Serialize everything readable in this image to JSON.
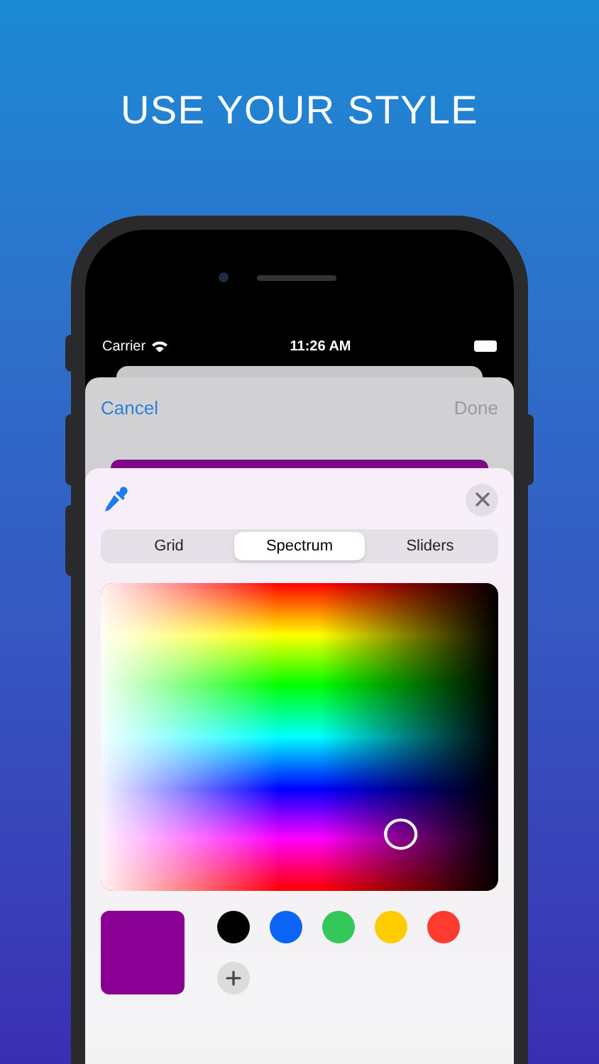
{
  "headline": "USE YOUR STYLE",
  "status_bar": {
    "carrier": "Carrier",
    "time": "11:26 AM"
  },
  "sheet": {
    "cancel": "Cancel",
    "done": "Done",
    "disabled_done": true,
    "preview": {
      "color": "#7c0a86"
    }
  },
  "picker": {
    "tabs": [
      {
        "label": "Grid",
        "selected": false
      },
      {
        "label": "Spectrum",
        "selected": true
      },
      {
        "label": "Sliders",
        "selected": false
      }
    ],
    "current": {
      "color": "#8b0094"
    },
    "swatches": [
      {
        "color": "#000000"
      },
      {
        "color": "#0a64f5"
      },
      {
        "color": "#34c759"
      },
      {
        "color": "#ffcc00"
      },
      {
        "color": "#ff3b30"
      }
    ]
  }
}
